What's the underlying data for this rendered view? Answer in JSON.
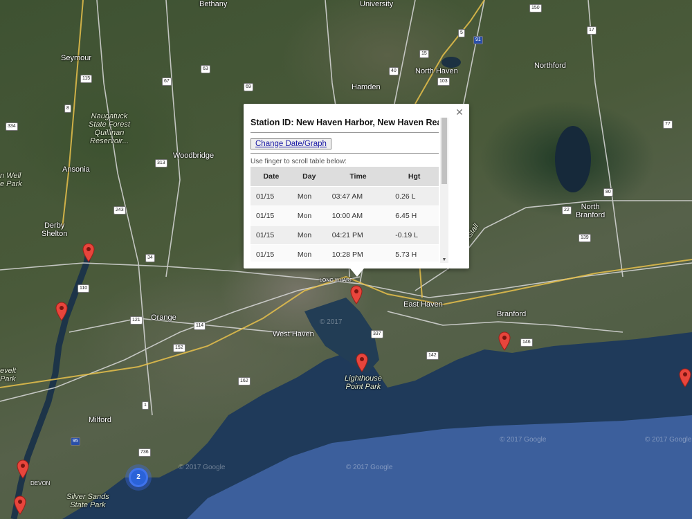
{
  "map": {
    "labels": {
      "bethany": "Bethany",
      "university": "University",
      "seymour": "Seymour",
      "north_haven": "North Haven",
      "hamden": "Hamden",
      "northford": "Northford",
      "naugatuck": "Naugatuck\nState Forest\nQuillinan\nReservoir...",
      "woodbridge": "Woodbridge",
      "ansonia": "Ansonia",
      "well_park": "n Well\ne Park",
      "derby_shelton": "Derby\nShelton",
      "north_branford": "North\nBranford",
      "orange": "Orange",
      "west_haven": "West Haven",
      "east_haven": "East Haven",
      "branford": "Branford",
      "lake_saltonstall": "Lake Saltonstall",
      "lighthouse": "Lighthouse\nPoint Park",
      "milford": "Milford",
      "devon": "DEVON",
      "silver_sands": "Silver Sands\nState Park",
      "evelt_park": "evelt\nPark",
      "long_wharf": "LONG WHARF"
    },
    "watermarks": [
      "© 2017 Google",
      "© 2017 Google",
      "© 2017 Google",
      "© 2017 Google",
      "© 2017"
    ],
    "route_shields": [
      "150",
      "17",
      "91",
      "5",
      "15",
      "63",
      "67",
      "40",
      "103",
      "115",
      "8",
      "69",
      "334",
      "313",
      "243",
      "34",
      "110",
      "121",
      "114",
      "152",
      "162",
      "1",
      "95",
      "337",
      "142",
      "146",
      "80",
      "22",
      "139",
      "77",
      "736"
    ],
    "cluster_count": "2"
  },
  "infowindow": {
    "title": "Station ID: New Haven Harbor, New Haven Reach",
    "change_button": "Change Date/Graph",
    "hint": "Use finger to scroll table below:",
    "columns": [
      "Date",
      "Day",
      "Time",
      "Hgt"
    ],
    "rows": [
      [
        "01/15",
        "Mon",
        "03:47 AM",
        "0.26 L"
      ],
      [
        "01/15",
        "Mon",
        "10:00 AM",
        "6.45 H"
      ],
      [
        "01/15",
        "Mon",
        "04:21 PM",
        "-0.19 L"
      ],
      [
        "01/15",
        "Mon",
        "10:28 PM",
        "5.73 H"
      ]
    ],
    "close_glyph": "✕"
  }
}
